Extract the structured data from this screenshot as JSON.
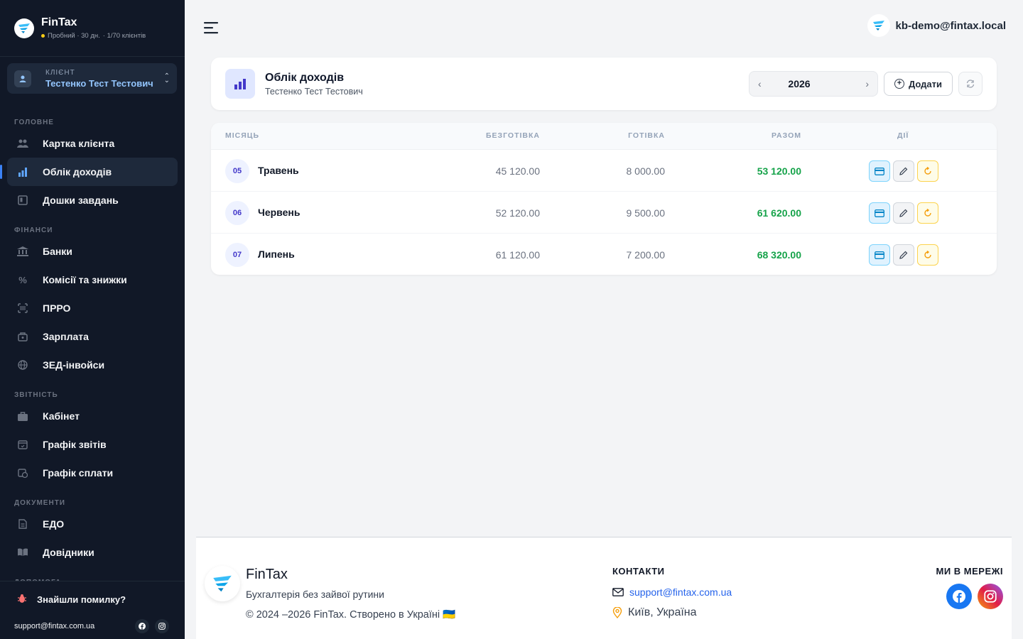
{
  "brand": {
    "name": "FinTax",
    "plan": "Пробний · 30 дн.",
    "clients": "· 1/70 клієнтів"
  },
  "client": {
    "label": "КЛІЄНТ",
    "name": "Тестенко Тест Тестович"
  },
  "nav": {
    "sections": [
      {
        "title": "ГОЛОВНЕ",
        "items": [
          {
            "label": "Картка клієнта",
            "icon": "users-icon"
          },
          {
            "label": "Облік доходів",
            "icon": "bar-chart-icon",
            "active": true
          },
          {
            "label": "Дошки завдань",
            "icon": "board-icon"
          }
        ]
      },
      {
        "title": "ФІНАНСИ",
        "items": [
          {
            "label": "Банки",
            "icon": "bank-icon"
          },
          {
            "label": "Комісії та знижки",
            "icon": "percent-icon"
          },
          {
            "label": "ПРРО",
            "icon": "barcode-icon"
          },
          {
            "label": "Зарплата",
            "icon": "wallet-icon"
          },
          {
            "label": "ЗЕД-інвойси",
            "icon": "globe-icon"
          }
        ]
      },
      {
        "title": "ЗВІТНІСТЬ",
        "items": [
          {
            "label": "Кабінет",
            "icon": "briefcase-icon"
          },
          {
            "label": "Графік звітів",
            "icon": "calendar-icon"
          },
          {
            "label": "Графік сплати",
            "icon": "payment-schedule-icon"
          }
        ]
      },
      {
        "title": "ДОКУМЕНТИ",
        "items": [
          {
            "label": "ЕДО",
            "icon": "document-icon"
          },
          {
            "label": "Довідники",
            "icon": "book-icon"
          }
        ]
      },
      {
        "title": "ДОПОМОГА",
        "items": []
      }
    ]
  },
  "sidebar_bottom": {
    "bug_label": "Знайшли помилку?",
    "support_email": "support@fintax.com.ua"
  },
  "user": {
    "email": "kb-demo@fintax.local"
  },
  "header": {
    "title": "Облік доходів",
    "subtitle": "Тестенко Тест Тестович",
    "year": "2026",
    "add_label": "Додати"
  },
  "table": {
    "columns": {
      "month": "МІСЯЦЬ",
      "cashless": "БЕЗГОТІВКА",
      "cash": "ГОТІВКА",
      "total": "РАЗОМ",
      "actions": "ДІЇ"
    },
    "rows": [
      {
        "num": "05",
        "month": "Травень",
        "cashless": "45 120.00",
        "cash": "8 000.00",
        "total": "53 120.00"
      },
      {
        "num": "06",
        "month": "Червень",
        "cashless": "52 120.00",
        "cash": "9 500.00",
        "total": "61 620.00"
      },
      {
        "num": "07",
        "month": "Липень",
        "cashless": "61 120.00",
        "cash": "7 200.00",
        "total": "68 320.00"
      }
    ]
  },
  "footer": {
    "brand": "FinTax",
    "tagline": "Бухгалтерія без зайвої рутини",
    "copyright": "© 2024 –2026 FinTax. Створено в Україні 🇺🇦",
    "contacts_title": "КОНТАКТИ",
    "email": "support@fintax.com.ua",
    "location": "Київ, Україна",
    "social_title": "МИ В МЕРЕЖІ"
  },
  "colors": {
    "sidebar_bg": "#111827",
    "accent": "#3b82f6",
    "total_green": "#16a34a"
  }
}
